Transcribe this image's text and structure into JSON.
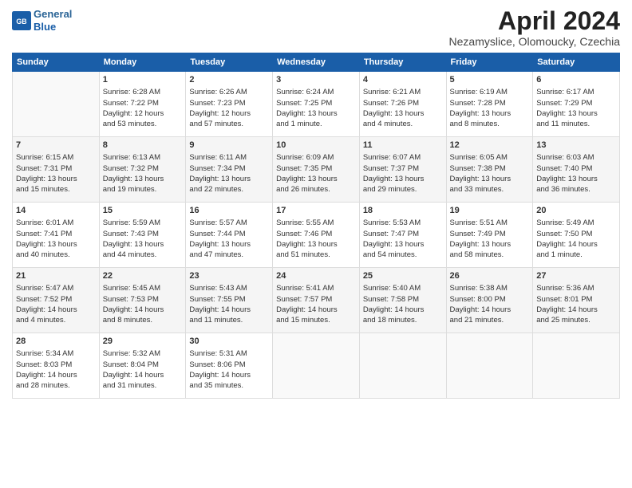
{
  "header": {
    "logo_line1": "General",
    "logo_line2": "Blue",
    "month": "April 2024",
    "location": "Nezamyslice, Olomoucky, Czechia"
  },
  "weekdays": [
    "Sunday",
    "Monday",
    "Tuesday",
    "Wednesday",
    "Thursday",
    "Friday",
    "Saturday"
  ],
  "weeks": [
    [
      {
        "day": "",
        "info": ""
      },
      {
        "day": "1",
        "info": "Sunrise: 6:28 AM\nSunset: 7:22 PM\nDaylight: 12 hours\nand 53 minutes."
      },
      {
        "day": "2",
        "info": "Sunrise: 6:26 AM\nSunset: 7:23 PM\nDaylight: 12 hours\nand 57 minutes."
      },
      {
        "day": "3",
        "info": "Sunrise: 6:24 AM\nSunset: 7:25 PM\nDaylight: 13 hours\nand 1 minute."
      },
      {
        "day": "4",
        "info": "Sunrise: 6:21 AM\nSunset: 7:26 PM\nDaylight: 13 hours\nand 4 minutes."
      },
      {
        "day": "5",
        "info": "Sunrise: 6:19 AM\nSunset: 7:28 PM\nDaylight: 13 hours\nand 8 minutes."
      },
      {
        "day": "6",
        "info": "Sunrise: 6:17 AM\nSunset: 7:29 PM\nDaylight: 13 hours\nand 11 minutes."
      }
    ],
    [
      {
        "day": "7",
        "info": "Sunrise: 6:15 AM\nSunset: 7:31 PM\nDaylight: 13 hours\nand 15 minutes."
      },
      {
        "day": "8",
        "info": "Sunrise: 6:13 AM\nSunset: 7:32 PM\nDaylight: 13 hours\nand 19 minutes."
      },
      {
        "day": "9",
        "info": "Sunrise: 6:11 AM\nSunset: 7:34 PM\nDaylight: 13 hours\nand 22 minutes."
      },
      {
        "day": "10",
        "info": "Sunrise: 6:09 AM\nSunset: 7:35 PM\nDaylight: 13 hours\nand 26 minutes."
      },
      {
        "day": "11",
        "info": "Sunrise: 6:07 AM\nSunset: 7:37 PM\nDaylight: 13 hours\nand 29 minutes."
      },
      {
        "day": "12",
        "info": "Sunrise: 6:05 AM\nSunset: 7:38 PM\nDaylight: 13 hours\nand 33 minutes."
      },
      {
        "day": "13",
        "info": "Sunrise: 6:03 AM\nSunset: 7:40 PM\nDaylight: 13 hours\nand 36 minutes."
      }
    ],
    [
      {
        "day": "14",
        "info": "Sunrise: 6:01 AM\nSunset: 7:41 PM\nDaylight: 13 hours\nand 40 minutes."
      },
      {
        "day": "15",
        "info": "Sunrise: 5:59 AM\nSunset: 7:43 PM\nDaylight: 13 hours\nand 44 minutes."
      },
      {
        "day": "16",
        "info": "Sunrise: 5:57 AM\nSunset: 7:44 PM\nDaylight: 13 hours\nand 47 minutes."
      },
      {
        "day": "17",
        "info": "Sunrise: 5:55 AM\nSunset: 7:46 PM\nDaylight: 13 hours\nand 51 minutes."
      },
      {
        "day": "18",
        "info": "Sunrise: 5:53 AM\nSunset: 7:47 PM\nDaylight: 13 hours\nand 54 minutes."
      },
      {
        "day": "19",
        "info": "Sunrise: 5:51 AM\nSunset: 7:49 PM\nDaylight: 13 hours\nand 58 minutes."
      },
      {
        "day": "20",
        "info": "Sunrise: 5:49 AM\nSunset: 7:50 PM\nDaylight: 14 hours\nand 1 minute."
      }
    ],
    [
      {
        "day": "21",
        "info": "Sunrise: 5:47 AM\nSunset: 7:52 PM\nDaylight: 14 hours\nand 4 minutes."
      },
      {
        "day": "22",
        "info": "Sunrise: 5:45 AM\nSunset: 7:53 PM\nDaylight: 14 hours\nand 8 minutes."
      },
      {
        "day": "23",
        "info": "Sunrise: 5:43 AM\nSunset: 7:55 PM\nDaylight: 14 hours\nand 11 minutes."
      },
      {
        "day": "24",
        "info": "Sunrise: 5:41 AM\nSunset: 7:57 PM\nDaylight: 14 hours\nand 15 minutes."
      },
      {
        "day": "25",
        "info": "Sunrise: 5:40 AM\nSunset: 7:58 PM\nDaylight: 14 hours\nand 18 minutes."
      },
      {
        "day": "26",
        "info": "Sunrise: 5:38 AM\nSunset: 8:00 PM\nDaylight: 14 hours\nand 21 minutes."
      },
      {
        "day": "27",
        "info": "Sunrise: 5:36 AM\nSunset: 8:01 PM\nDaylight: 14 hours\nand 25 minutes."
      }
    ],
    [
      {
        "day": "28",
        "info": "Sunrise: 5:34 AM\nSunset: 8:03 PM\nDaylight: 14 hours\nand 28 minutes."
      },
      {
        "day": "29",
        "info": "Sunrise: 5:32 AM\nSunset: 8:04 PM\nDaylight: 14 hours\nand 31 minutes."
      },
      {
        "day": "30",
        "info": "Sunrise: 5:31 AM\nSunset: 8:06 PM\nDaylight: 14 hours\nand 35 minutes."
      },
      {
        "day": "",
        "info": ""
      },
      {
        "day": "",
        "info": ""
      },
      {
        "day": "",
        "info": ""
      },
      {
        "day": "",
        "info": ""
      }
    ]
  ]
}
